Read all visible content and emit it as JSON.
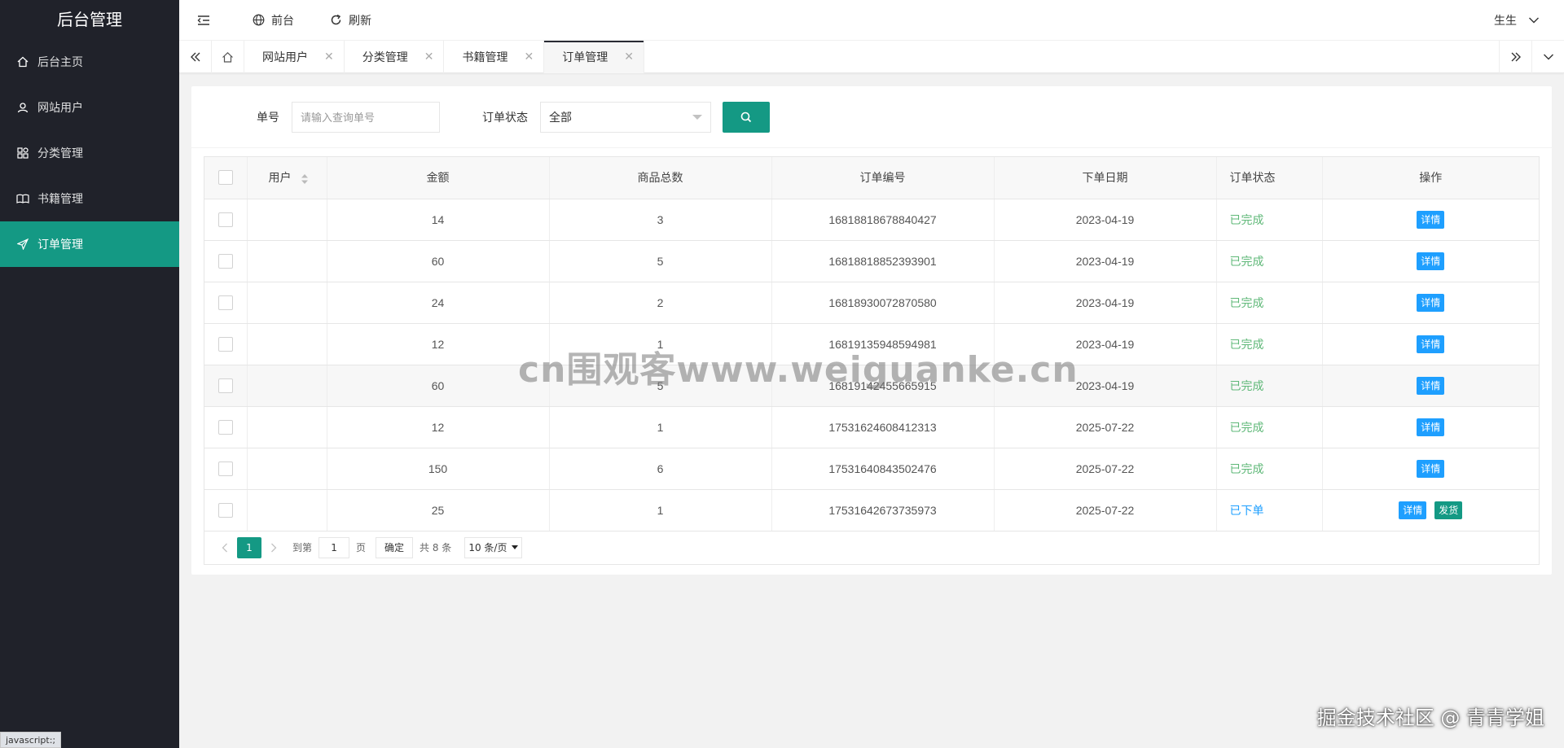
{
  "sidebar": {
    "title": "后台管理",
    "items": [
      {
        "label": "后台主页",
        "icon": "home-icon",
        "active": false
      },
      {
        "label": "网站用户",
        "icon": "user-icon",
        "active": false
      },
      {
        "label": "分类管理",
        "icon": "category-icon",
        "active": false
      },
      {
        "label": "书籍管理",
        "icon": "book-icon",
        "active": false
      },
      {
        "label": "订单管理",
        "icon": "send-icon",
        "active": true
      }
    ]
  },
  "header": {
    "frontend_label": "前台",
    "refresh_label": "刷新",
    "username": "生生"
  },
  "tabs": [
    {
      "label": "网站用户",
      "active": false
    },
    {
      "label": "分类管理",
      "active": false
    },
    {
      "label": "书籍管理",
      "active": false
    },
    {
      "label": "订单管理",
      "active": true
    }
  ],
  "search": {
    "order_no_label": "单号",
    "order_no_placeholder": "请输入查询单号",
    "status_label": "订单状态",
    "status_value": "全部"
  },
  "table": {
    "columns": [
      "用户",
      "金额",
      "商品总数",
      "订单编号",
      "下单日期",
      "订单状态",
      "操作"
    ],
    "rows": [
      {
        "user": "",
        "amount": "14",
        "count": "3",
        "order_no": "16818818678840427",
        "date": "2023-04-19",
        "status": "已完成",
        "actions": [
          "详情"
        ]
      },
      {
        "user": "",
        "amount": "60",
        "count": "5",
        "order_no": "16818818852393901",
        "date": "2023-04-19",
        "status": "已完成",
        "actions": [
          "详情"
        ]
      },
      {
        "user": "",
        "amount": "24",
        "count": "2",
        "order_no": "16818930072870580",
        "date": "2023-04-19",
        "status": "已完成",
        "actions": [
          "详情"
        ]
      },
      {
        "user": "",
        "amount": "12",
        "count": "1",
        "order_no": "16819135948594981",
        "date": "2023-04-19",
        "status": "已完成",
        "actions": [
          "详情"
        ]
      },
      {
        "user": "",
        "amount": "60",
        "count": "5",
        "order_no": "16819142455665915",
        "date": "2023-04-19",
        "status": "已完成",
        "actions": [
          "详情"
        ]
      },
      {
        "user": "",
        "amount": "12",
        "count": "1",
        "order_no": "17531624608412313",
        "date": "2025-07-22",
        "status": "已完成",
        "actions": [
          "详情"
        ]
      },
      {
        "user": "",
        "amount": "150",
        "count": "6",
        "order_no": "17531640843502476",
        "date": "2025-07-22",
        "status": "已完成",
        "actions": [
          "详情"
        ]
      },
      {
        "user": "",
        "amount": "25",
        "count": "1",
        "order_no": "17531642673735973",
        "date": "2025-07-22",
        "status": "已下单",
        "actions": [
          "详情",
          "发货"
        ]
      }
    ]
  },
  "pager": {
    "current": "1",
    "goto_label": "到第",
    "page_input": "1",
    "page_label": "页",
    "confirm_label": "确定",
    "total_label": "共 8 条",
    "limit_label": "10 条/页"
  },
  "watermark": "cn围观客www.weiguanke.cn",
  "watermark2": "掘金技术社区 @ 青青学姐",
  "statusbar": "javascript:;",
  "colors": {
    "sidebar_bg": "#20222a",
    "accent": "#149984",
    "detail_btn": "#1e9fff",
    "done_status": "#5fb878",
    "ordered_status": "#1e9fff"
  }
}
